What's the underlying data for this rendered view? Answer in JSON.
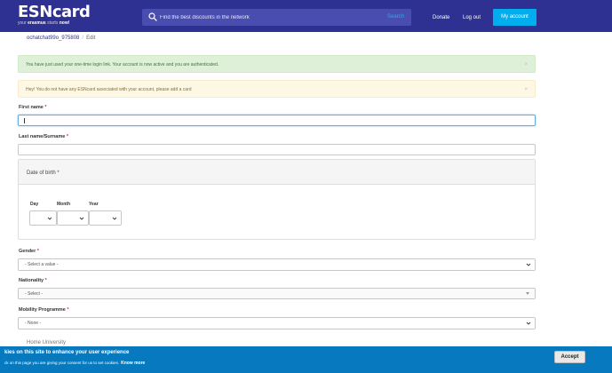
{
  "header": {
    "logo_title": "ESNcard",
    "logo_tagline_prefix": "your ",
    "logo_tagline_bold": "erasmus",
    "logo_tagline_middle": " starts ",
    "logo_tagline_end": "now!",
    "search_placeholder": "Find the best discounts in the network",
    "search_button": "Search",
    "donate": "Donate",
    "logout": "Log out",
    "my_account": "My account"
  },
  "breadcrumb": {
    "user": "ochatchat99o_975808",
    "edit": "Edit"
  },
  "alerts": {
    "success": "You have just used your one-time login link. Your account is now active and you are authenticated.",
    "warning": "Hey! You do not have any ESNcard associated with your account, please add a card",
    "close": "×"
  },
  "form": {
    "required_mark": "*",
    "first_name_label": "First name",
    "first_name_value": "",
    "last_name_label": "Last name/Surname",
    "last_name_value": "",
    "dob_title": "Date of birth",
    "day_label": "Day",
    "month_label": "Month",
    "year_label": "Year",
    "gender_label": "Gender",
    "gender_value": "- Select a value -",
    "nationality_label": "Nationality",
    "nationality_value": "- Select -",
    "mobility_label": "Mobility Programme",
    "mobility_value": "- None -",
    "home_university_label": "Home University"
  },
  "cookie": {
    "title": "kies on this site to enhance your user experience",
    "text": "ck on this page you are giving your consent for us to set cookies.",
    "link": "Know more",
    "accept": "Accept"
  },
  "colors": {
    "header_bg": "#2e3192",
    "accent": "#00aeef",
    "cookie_bg": "#0779bf"
  }
}
